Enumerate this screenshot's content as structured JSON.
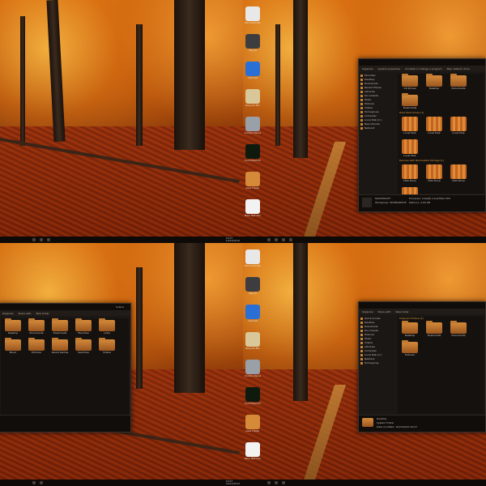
{
  "dock": {
    "items": [
      {
        "label": "Microsoft Word",
        "icon": "word-icon",
        "color": "#e8e8e8"
      },
      {
        "label": "Tag All",
        "icon": "tag-icon",
        "color": "#3d3d40"
      },
      {
        "label": "Internet",
        "icon": "globe-icon",
        "color": "#2a6fd6"
      },
      {
        "label": "Recycle Bin",
        "icon": "recycle-bin-icon",
        "color": "#d9c79a"
      },
      {
        "label": "Control Panel",
        "icon": "control-panel-icon",
        "color": "#9aa0a8"
      },
      {
        "label": "Command Prompt",
        "icon": "terminal-icon",
        "color": "#0d1a0d"
      },
      {
        "label": "Give Folder",
        "icon": "folder-icon",
        "color": "#d58a3a"
      },
      {
        "label": "New Text Document",
        "icon": "document-icon",
        "color": "#f2f2f2"
      }
    ]
  },
  "taskbar": {
    "clock_time": "10:07",
    "clock_date": "10/23/2010"
  },
  "win_top_right": {
    "toolbar": [
      "Organize",
      "System properties",
      "Uninstall or change a program",
      "Map network drive",
      "Open Control Panel"
    ],
    "nav": [
      "Favorites",
      "Desktop",
      "Downloads",
      "Recent Places",
      "Libraries",
      "Documents",
      "Music",
      "Pictures",
      "Videos",
      "Homegroup",
      "Computer",
      "Local Disk (C:)",
      "New Volume",
      "Network"
    ],
    "section_devices": "Hard Disk Drives (7)",
    "section_removable": "Devices with Removable Storage (1)",
    "folders": [
      "CD Drives",
      "Desktop",
      "Documents",
      "Downloads"
    ],
    "drives": [
      "Local Disk",
      "Local Disk",
      "Local Disk",
      "Local Disk"
    ],
    "drives2": [
      "DVD Drive",
      "DVD Drive",
      "DVD Drive",
      "DVD Drive"
    ],
    "details": {
      "name": "MACHOSOFT",
      "workgroup": "Workgroup: WORKGROUP",
      "processor": "Processor: Intel(R) Core(TM)2 CPU",
      "memory": "Memory: 4.00 GB"
    }
  },
  "win_bottom_left": {
    "toolbar": [
      "Organize",
      "Share with",
      "New folder"
    ],
    "title": "Solaris",
    "row1": [
      "Desktop",
      "Documents",
      "Downloads",
      "Favorites",
      "Links"
    ],
    "row2": [
      "Music",
      "Pictures",
      "Saved Games",
      "Searches",
      "Videos"
    ]
  },
  "win_bottom_right": {
    "toolbar": [
      "Organize",
      "Share with",
      "New folder"
    ],
    "section": "Frequent folders (4)",
    "folders": [
      "Desktop",
      "Downloads",
      "Documents",
      "Pictures"
    ],
    "nav": [
      "Quick access",
      "Desktop",
      "Downloads",
      "Documents",
      "Pictures",
      "Music",
      "Videos",
      "Libraries",
      "Computer",
      "Local Disk (C:)",
      "Network",
      "Homegroup"
    ],
    "details": {
      "name": "Desktop",
      "type": "System Folder",
      "modified": "Date modified: 10/23/2010 10:07"
    }
  }
}
